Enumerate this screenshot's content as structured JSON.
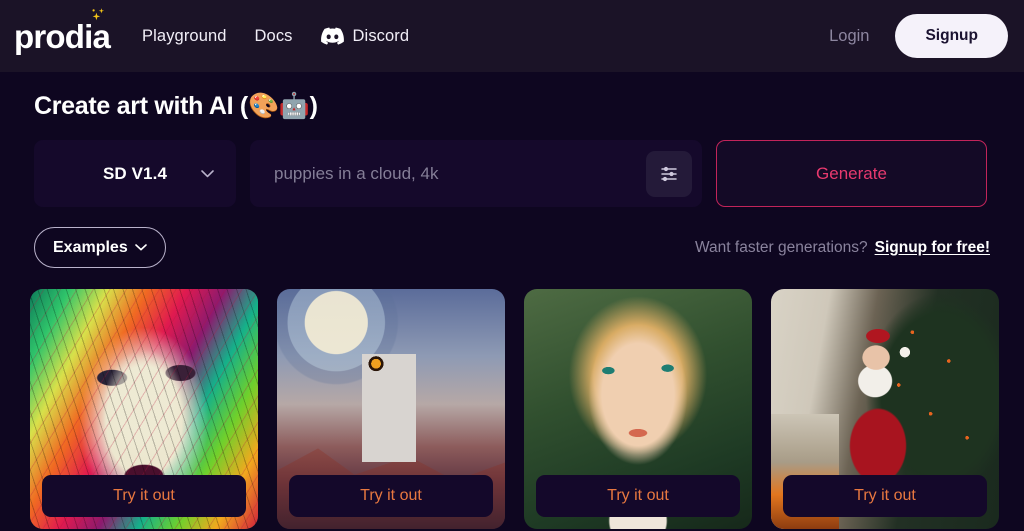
{
  "header": {
    "logo_text": "prodia",
    "logo_icon": "sparkles-icon",
    "nav": [
      {
        "label": "Playground",
        "name": "nav-playground"
      },
      {
        "label": "Docs",
        "name": "nav-docs"
      },
      {
        "label": "Discord",
        "name": "nav-discord",
        "icon": "discord-icon"
      }
    ],
    "login_label": "Login",
    "signup_label": "Signup"
  },
  "main": {
    "title": "Create art with AI (🎨🤖)",
    "model_select": {
      "value": "SD V1.4",
      "icon": "chevron-down-icon"
    },
    "prompt": {
      "value": "",
      "placeholder": "puppies in a cloud, 4k",
      "settings_icon": "sliders-icon"
    },
    "generate_label": "Generate",
    "examples_label": "Examples",
    "examples_icon": "chevron-down-icon",
    "faster_text": "Want faster generations?",
    "faster_link": "Signup for free!"
  },
  "cards": [
    {
      "name": "example-card-colorful-portrait",
      "try_label": "Try it out"
    },
    {
      "name": "example-card-astronaut-horse",
      "try_label": "Try it out"
    },
    {
      "name": "example-card-blonde-portrait",
      "try_label": "Try it out"
    },
    {
      "name": "example-card-santa",
      "try_label": "Try it out"
    }
  ],
  "colors": {
    "page_bg": "#0e0620",
    "header_bg": "#1b1327",
    "field_bg": "#15092b",
    "accent_pink": "#e8396e",
    "accent_border": "#c2245a",
    "accent_orange": "#e87840",
    "sparkle_gold": "#f5c518",
    "muted_text": "#8a839d"
  }
}
